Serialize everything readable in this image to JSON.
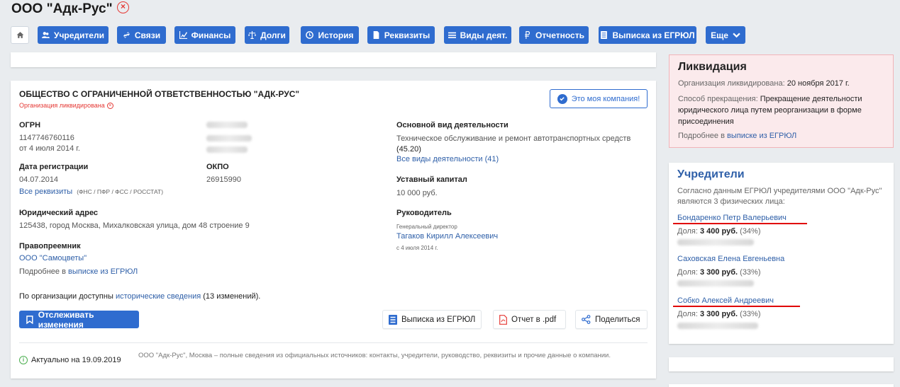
{
  "header": {
    "title": "ООО \"Адк-Рус\"",
    "close_icon": "×"
  },
  "nav": [
    {
      "label": "Учредители",
      "icon": "users-icon"
    },
    {
      "label": "Связи",
      "icon": "link-icon"
    },
    {
      "label": "Финансы",
      "icon": "chart-icon"
    },
    {
      "label": "Долги",
      "icon": "scales-icon"
    },
    {
      "label": "История",
      "icon": "history-icon"
    },
    {
      "label": "Реквизиты",
      "icon": "document-icon"
    },
    {
      "label": "Виды деят.",
      "icon": "list-icon"
    },
    {
      "label": "Отчетность",
      "icon": "ruble-icon"
    },
    {
      "label": "Выписка из ЕГРЮЛ",
      "icon": "extract-icon"
    },
    {
      "label": "Еще",
      "icon": "chevron-down-icon"
    }
  ],
  "company": {
    "full_name": "ОБЩЕСТВО С ОГРАНИЧЕННОЙ ОТВЕТСТВЕННОСТЬЮ \"АДК-РУС\"",
    "status": "Организация ликвидирована",
    "my_company_btn": "Это моя компания!",
    "ogrn_label": "ОГРН",
    "ogrn_value": "1147746760116",
    "ogrn_date": "от 4 июля 2014 г.",
    "reg_label": "Дата регистрации",
    "reg_value": "04.07.2014",
    "all_requisites": "Все реквизиты",
    "requisites_note": "(ФНС / ПФР / ФСС / РОССТАТ)",
    "okpo_label": "ОКПО",
    "okpo_value": "26915990",
    "address_label": "Юридический адрес",
    "address_value": "125438, город Москва, Михалковская улица, дом 48 строение 9",
    "successor_label": "Правопреемник",
    "successor_value": "ООО \"Самоцветы\"",
    "more_in": "Подробнее в",
    "egrul_link": "выписке из ЕГРЮЛ",
    "activity_label": "Основной вид деятельности",
    "activity_value": "Техническое обслуживание и ремонт автотранспортных средств",
    "activity_code": "(45.20)",
    "all_activities": "Все виды деятельности (41)",
    "capital_label": "Уставный капитал",
    "capital_value": "10 000 руб.",
    "head_label": "Руководитель",
    "head_role": "Генеральный директор",
    "head_name": "Тагаков Кирилл Алексеевич",
    "head_since": "с 4 июля 2014 г.",
    "history_prefix": "По организации доступны",
    "history_link": "исторические сведения",
    "history_suffix": "(13 изменений).",
    "track_btn": "Отслеживать изменения",
    "egrul_btn": "Выписка из ЕГРЮЛ",
    "pdf_btn": "Отчет в .pdf",
    "share_btn": "Поделиться",
    "actual_text": "Актуально на 19.09.2019",
    "footer_text": "ООО \"Адк-Рус\", Москва – полные сведения из официальных источников: контакты, учредители, руководство, реквизиты и прочие данные о компании."
  },
  "liquidation": {
    "title": "Ликвидация",
    "liquidated_label": "Организация ликвидирована:",
    "liquidated_date": "20 ноября 2017 г.",
    "method_label": "Способ прекращения:",
    "method_value": "Прекращение деятельности юридического лица путем реорганизации в форме присоединения",
    "more_in": "Подробнее в",
    "egrul_link": "выписке из ЕГРЮЛ"
  },
  "founders": {
    "title": "Учредители",
    "intro": "Согласно данным ЕГРЮЛ учредителями ООО \"Адк-Рус\" являются 3 физических лица:",
    "share_label": "Доля:",
    "items": [
      {
        "name": "Бондаренко Петр Валерьевич",
        "amount": "3 400 руб.",
        "percent": "(34%)"
      },
      {
        "name": "Саховская Елена Евгеньевна",
        "amount": "3 300 руб.",
        "percent": "(33%)"
      },
      {
        "name": "Собко Алексей Андреевич",
        "amount": "3 300 руб.",
        "percent": "(33%)"
      }
    ]
  },
  "colors": {
    "accent": "#2f6ccf",
    "danger": "#e53935",
    "liquidation_bg": "#fbeaec"
  }
}
